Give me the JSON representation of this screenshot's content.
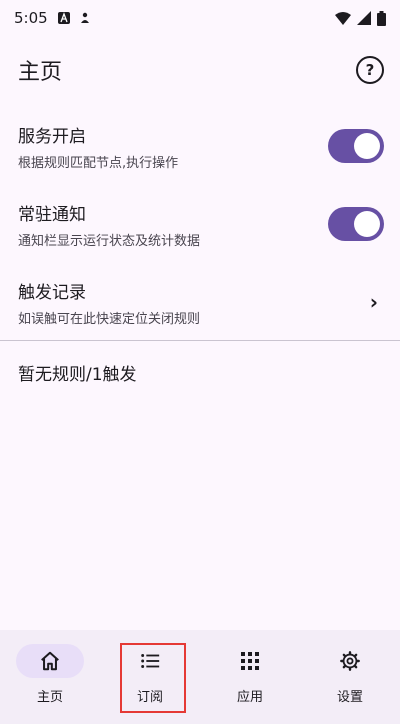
{
  "status_bar": {
    "time": "5:05"
  },
  "app_bar": {
    "title": "主页",
    "help_icon": "help-circle-icon"
  },
  "settings": [
    {
      "title": "服务开启",
      "subtitle": "根据规则匹配节点,执行操作",
      "control": "switch",
      "checked": true
    },
    {
      "title": "常驻通知",
      "subtitle": "通知栏显示运行状态及统计数据",
      "control": "switch",
      "checked": true
    },
    {
      "title": "触发记录",
      "subtitle": "如误触可在此快速定位关闭规则",
      "control": "chevron"
    }
  ],
  "rule_summary": "暂无规则/1触发",
  "bottom_nav": [
    {
      "label": "主页",
      "icon": "home-icon",
      "active": true
    },
    {
      "label": "订阅",
      "icon": "list-icon",
      "active": false
    },
    {
      "label": "应用",
      "icon": "apps-grid-icon",
      "active": false
    },
    {
      "label": "设置",
      "icon": "gear-icon",
      "active": false
    }
  ],
  "colors": {
    "accent": "#6750a4",
    "nav_active": "#e8def8",
    "highlight": "#e53935"
  }
}
